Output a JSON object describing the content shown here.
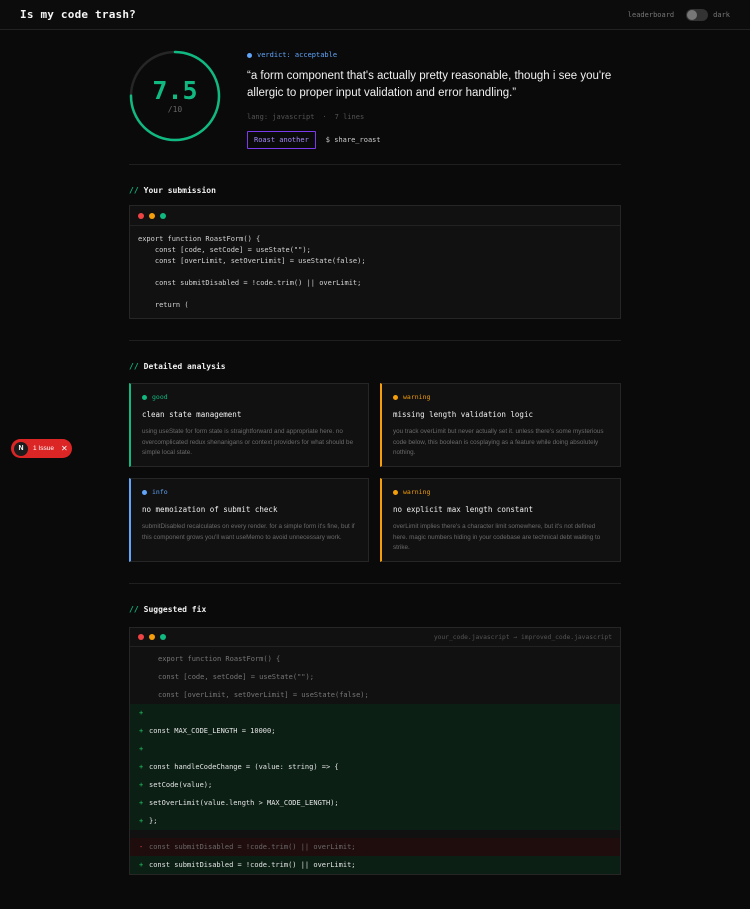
{
  "header": {
    "title": "Is my code trash?",
    "leaderboard": "leaderboard",
    "theme_label": "dark"
  },
  "score": {
    "value": "7.5",
    "max": "/10",
    "fraction": 0.75,
    "color": "#10b981",
    "verdict": "verdict: acceptable",
    "quote": "“a form component that's actually pretty reasonable, though i see you're allergic to proper input validation and error handling.”",
    "lang": "lang: javascript",
    "separator": "·",
    "lines": "7 lines",
    "roast_button": "Roast another",
    "share": "$ share_roast"
  },
  "submission": {
    "slash": "//",
    "title": "Your submission",
    "code": [
      "export function RoastForm() {",
      "    const [code, setCode] = useState(\"\");",
      "    const [overLimit, setOverLimit] = useState(false);",
      "",
      "    const submitDisabled = !code.trim() || overLimit;",
      "",
      "    return ("
    ]
  },
  "analysis": {
    "slash": "//",
    "title": "Detailed analysis",
    "cards": [
      {
        "tag": "good",
        "color": "#10b981",
        "title": "clean state management",
        "desc": "using useState for form state is straightforward and appropriate here. no overcomplicated redux shenanigans or context providers for what should be simple local state."
      },
      {
        "tag": "warning",
        "color": "#f59e0b",
        "title": "missing length validation logic",
        "desc": "you track overLimit but never actually set it. unless there's some mysterious code below, this boolean is cosplaying as a feature while doing absolutely nothing."
      },
      {
        "tag": "info",
        "color": "#60a5fa",
        "title": "no memoization of submit check",
        "desc": "submitDisabled recalculates on every render. for a simple form it's fine, but if this component grows you'll want useMemo to avoid unnecessary work."
      },
      {
        "tag": "warning",
        "color": "#f59e0b",
        "title": "no explicit max length constant",
        "desc": "overLimit implies there's a character limit somewhere, but it's not defined here. magic numbers hiding in your codebase are technical debt waiting to strike."
      }
    ]
  },
  "fix": {
    "slash": "//",
    "title": "Suggested fix",
    "path": "your_code.javascript → improved_code.javascript",
    "lines": [
      {
        "type": "ctx",
        "sign": " ",
        "text": "export function RoastForm() {"
      },
      {
        "type": "ctx",
        "sign": " ",
        "text": "const [code, setCode] = useState(\"\");"
      },
      {
        "type": "ctx",
        "sign": " ",
        "text": "const [overLimit, setOverLimit] = useState(false);"
      },
      {
        "type": "add",
        "sign": "+",
        "text": ""
      },
      {
        "type": "add",
        "sign": "+",
        "text": "const MAX_CODE_LENGTH = 10000;"
      },
      {
        "type": "add",
        "sign": "+",
        "text": ""
      },
      {
        "type": "add",
        "sign": "+",
        "text": "const handleCodeChange = (value: string) => {"
      },
      {
        "type": "add",
        "sign": "+",
        "text": "setCode(value);"
      },
      {
        "type": "add",
        "sign": "+",
        "text": "setOverLimit(value.length > MAX_CODE_LENGTH);"
      },
      {
        "type": "add",
        "sign": "+",
        "text": "};"
      },
      {
        "type": "add",
        "sign": " ",
        "text": ""
      },
      {
        "type": "del",
        "sign": "-",
        "text": "const submitDisabled = !code.trim() || overLimit;"
      },
      {
        "type": "add",
        "sign": "+",
        "text": "const submitDisabled = !code.trim() || overLimit;"
      }
    ]
  },
  "issue_badge": {
    "letter": "N",
    "label": "1 Issue",
    "close": "✕"
  }
}
